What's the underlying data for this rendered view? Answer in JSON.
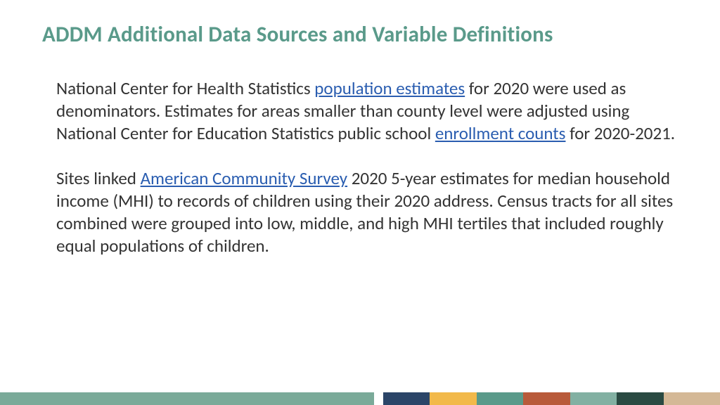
{
  "slide": {
    "title": "ADDM Additional Data Sources and Variable Definitions",
    "paragraph1": {
      "part1": "National Center for Health Statistics ",
      "link1": "population estimates",
      "part2": " for 2020 were used as denominators. Estimates for areas smaller than county level were adjusted using National Center for Education Statistics public school ",
      "link2": "enrollment counts",
      "part3": " for 2020-2021."
    },
    "paragraph2": {
      "part1": "Sites linked ",
      "link1": "American Community Survey",
      "part2": " 2020 5-year estimates for median household income (MHI) to records of children using their 2020 address. Census tracts for all sites combined were grouped into low, middle, and high MHI tertiles that included roughly equal populations of children."
    }
  },
  "footer_colors": [
    "#7aaa99",
    "#ffffff",
    "#2b4568",
    "#f2b94a",
    "#5a9a8a",
    "#b85a3a",
    "#82b0a2",
    "#2a4a42",
    "#d4b896"
  ]
}
